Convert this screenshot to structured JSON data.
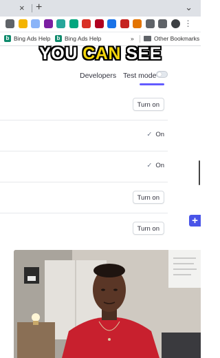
{
  "browser": {
    "tab_close_glyph": "×",
    "new_tab_glyph": "+",
    "tab_menu_glyph": "⌄",
    "extensions": [
      {
        "icon": "camera-icon",
        "color": "#5f6368"
      },
      {
        "icon": "extension-color-icon",
        "color": "#f4b400"
      },
      {
        "icon": "grammar-icon",
        "color": "#8ab4f8"
      },
      {
        "icon": "colorwheel-icon",
        "color": "#7b1fa2"
      },
      {
        "icon": "drop-icon",
        "color": "#26a69a"
      },
      {
        "icon": "v-check-icon",
        "color": "#00a67e"
      },
      {
        "icon": "shield-icon",
        "color": "#d93025"
      },
      {
        "icon": "clock-icon",
        "color": "#b00020"
      },
      {
        "icon": "globe-icon",
        "color": "#1a73e8"
      },
      {
        "icon": "translate-icon",
        "color": "#c5221f"
      },
      {
        "icon": "lock-icon",
        "color": "#e37400"
      },
      {
        "icon": "timer-icon",
        "color": "#5f6368"
      },
      {
        "icon": "puzzle-icon",
        "color": "#5f6368"
      },
      {
        "icon": "avatar-icon",
        "color": "#3c4043"
      },
      {
        "icon": "menu-dots-icon",
        "color": "#5f6368"
      }
    ]
  },
  "bookmarks": {
    "items": [
      "Bing Ads Help",
      "Bing Ads Help"
    ],
    "overflow_glyph": "»",
    "other_label": "Other Bookmarks"
  },
  "caption": {
    "part1": "YOU ",
    "highlight": "CAN",
    "part2": " SEE"
  },
  "header": {
    "developers_label": "Developers",
    "test_mode_label": "Test mode",
    "test_mode_on": false
  },
  "rows": [
    {
      "type": "button",
      "label": "Turn on"
    },
    {
      "type": "status",
      "check": "✓",
      "label": "On"
    },
    {
      "type": "status",
      "check": "✓",
      "label": "On"
    },
    {
      "type": "button",
      "label": "Turn on"
    },
    {
      "type": "button",
      "label": "Turn on"
    }
  ],
  "floating_button": "+",
  "colors": {
    "accent": "#635bff",
    "caption_highlight": "#f5d60c",
    "plus_button": "#4954e8"
  }
}
